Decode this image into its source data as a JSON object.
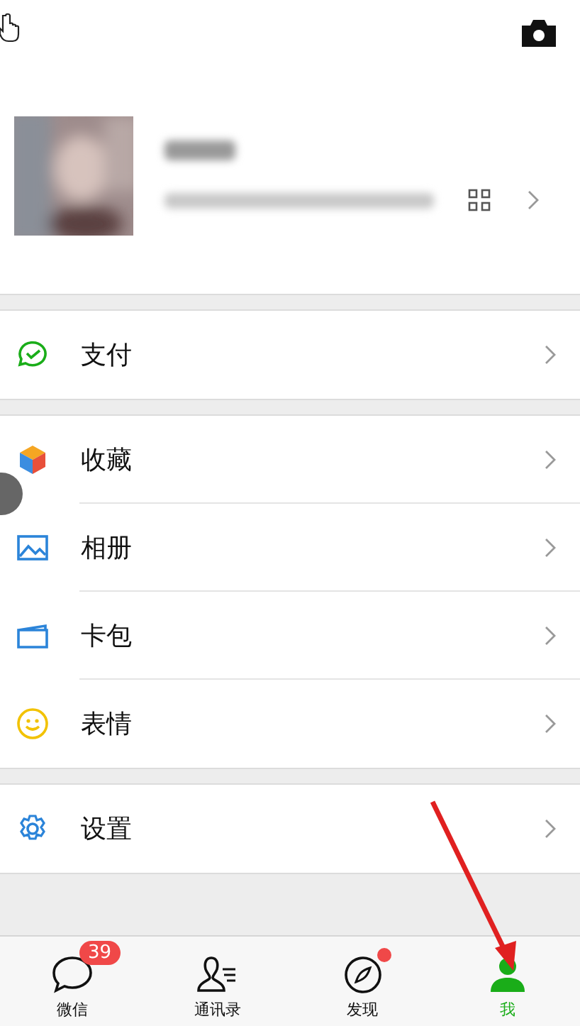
{
  "sections": [
    {
      "items": [
        {
          "label": "支付"
        }
      ]
    },
    {
      "items": [
        {
          "label": "收藏"
        },
        {
          "label": "相册"
        },
        {
          "label": "卡包"
        },
        {
          "label": "表情"
        }
      ]
    },
    {
      "items": [
        {
          "label": "设置"
        }
      ]
    }
  ],
  "tabs": [
    {
      "label": "微信",
      "selected": false,
      "badge": "39",
      "dot": false
    },
    {
      "label": "通讯录",
      "selected": false,
      "dot": false
    },
    {
      "label": "发现",
      "selected": false,
      "dot": true
    },
    {
      "label": "我",
      "selected": true,
      "dot": false
    }
  ]
}
